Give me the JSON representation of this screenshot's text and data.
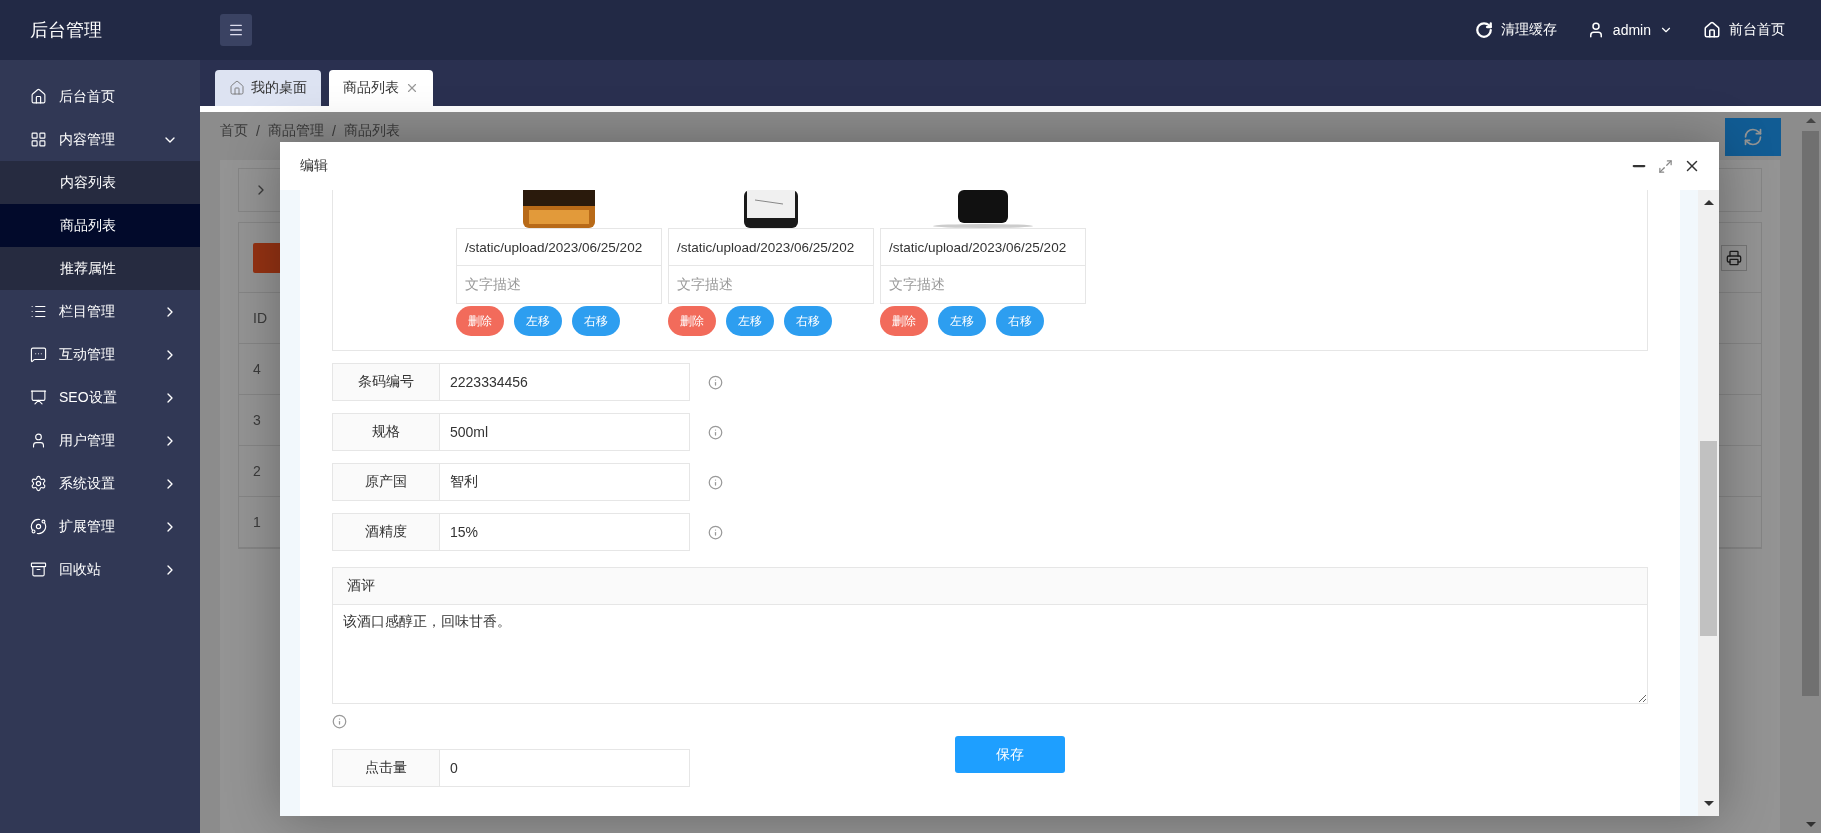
{
  "header": {
    "logo": "后台管理",
    "actions": [
      {
        "kind": "refresh",
        "label": "清理缓存"
      },
      {
        "kind": "user",
        "label": "admin"
      },
      {
        "kind": "home",
        "label": "前台首页"
      }
    ]
  },
  "sidebar": {
    "items": [
      {
        "kind": "link",
        "label": "后台首页"
      },
      {
        "kind": "menu",
        "label": "内容管理",
        "expanded": true,
        "children": [
          {
            "label": "内容列表",
            "selected": false
          },
          {
            "label": "商品列表",
            "selected": true
          },
          {
            "label": "推荐属性",
            "selected": false
          }
        ]
      },
      {
        "kind": "menu",
        "label": "栏目管理",
        "expanded": false
      },
      {
        "kind": "menu",
        "label": "互动管理",
        "expanded": false
      },
      {
        "kind": "menu",
        "label": "SEO设置",
        "expanded": false
      },
      {
        "kind": "menu",
        "label": "用户管理",
        "expanded": false
      },
      {
        "kind": "menu",
        "label": "系统设置",
        "expanded": false
      },
      {
        "kind": "menu",
        "label": "扩展管理",
        "expanded": false
      },
      {
        "kind": "menu",
        "label": "回收站",
        "expanded": false
      }
    ]
  },
  "tabs": [
    {
      "label": "我的桌面",
      "selected": false,
      "closable": false
    },
    {
      "label": "商品列表",
      "selected": true,
      "closable": true
    }
  ],
  "breadcrumb": {
    "separator": "/",
    "items": [
      "首页",
      "商品管理",
      "商品列表"
    ]
  },
  "table": {
    "columns": [
      "ID"
    ],
    "rows": [
      "4",
      "3",
      "2",
      "1"
    ]
  },
  "modal": {
    "title": "编辑",
    "images": [
      {
        "path": "/static/upload/2023/06/25/202",
        "placeholder": "文字描述",
        "buttons": [
          {
            "kind": "delete",
            "label": "删除"
          },
          {
            "kind": "move",
            "label": "左移"
          },
          {
            "kind": "move",
            "label": "右移"
          }
        ]
      },
      {
        "path": "/static/upload/2023/06/25/202",
        "placeholder": "文字描述",
        "buttons": [
          {
            "kind": "delete",
            "label": "删除"
          },
          {
            "kind": "move",
            "label": "左移"
          },
          {
            "kind": "move",
            "label": "右移"
          }
        ]
      },
      {
        "path": "/static/upload/2023/06/25/202",
        "placeholder": "文字描述",
        "buttons": [
          {
            "kind": "delete",
            "label": "删除"
          },
          {
            "kind": "move",
            "label": "左移"
          },
          {
            "kind": "move",
            "label": "右移"
          }
        ]
      }
    ],
    "fields": [
      {
        "label": "条码编号",
        "value": "2223334456"
      },
      {
        "label": "规格",
        "value": "500ml"
      },
      {
        "label": "原产国",
        "value": "智利"
      },
      {
        "label": "酒精度",
        "value": "15%"
      }
    ],
    "review": {
      "label": "酒评",
      "value": "该酒口感醇正，回味甘香。"
    },
    "clicks": {
      "label": "点击量",
      "value": "0"
    },
    "save": "保存"
  }
}
